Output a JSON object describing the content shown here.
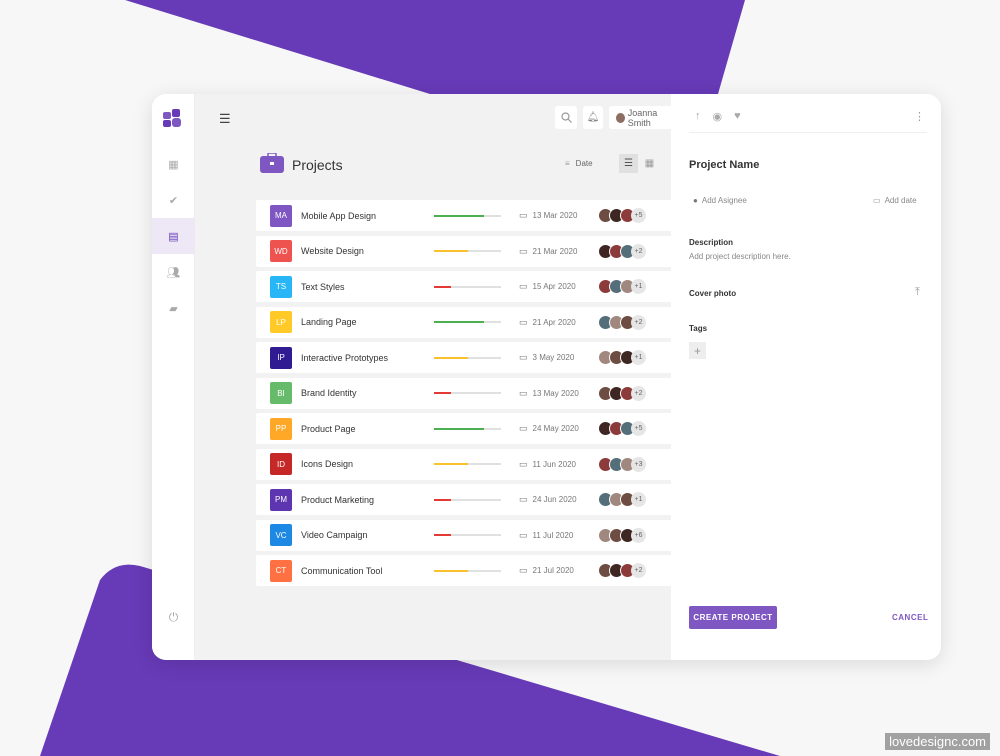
{
  "colors": {
    "accent": "#673ab7",
    "green": "#4caf50",
    "yellow": "#fbc02d",
    "red": "#e53935"
  },
  "header": {
    "user_name": "Joanna Smith",
    "icons": [
      "menu-icon",
      "search-icon",
      "bell-icon",
      "kebab-icon"
    ]
  },
  "sidebar": {
    "items": [
      {
        "icon": "dashboard-icon"
      },
      {
        "icon": "check-circle-icon"
      },
      {
        "icon": "clipboard-icon",
        "active": true
      },
      {
        "icon": "people-icon"
      },
      {
        "icon": "chat-icon"
      }
    ],
    "bottom_icon": "power-icon"
  },
  "main": {
    "title": "Projects",
    "sort_label": "Date",
    "views": [
      "list",
      "grid"
    ],
    "active_view": "list",
    "projects": [
      {
        "initials": "MA",
        "name": "Mobile App Design",
        "color": "#7e57c2",
        "progress": 75,
        "status": "green",
        "date": "13 Mar 2020",
        "extra": "+5"
      },
      {
        "initials": "WD",
        "name": "Website Design",
        "color": "#ef5350",
        "progress": 50,
        "status": "yellow",
        "date": "21 Mar 2020",
        "extra": "+2"
      },
      {
        "initials": "TS",
        "name": "Text Styles",
        "color": "#29b6f6",
        "progress": 25,
        "status": "red",
        "date": "15 Apr 2020",
        "extra": "+1"
      },
      {
        "initials": "LP",
        "name": "Landing Page",
        "color": "#ffca28",
        "progress": 75,
        "status": "green",
        "date": "21 Apr 2020",
        "extra": "+2"
      },
      {
        "initials": "IP",
        "name": "Interactive Prototypes",
        "color": "#311b92",
        "progress": 50,
        "status": "yellow",
        "date": "3 May 2020",
        "extra": "+1"
      },
      {
        "initials": "BI",
        "name": "Brand Identity",
        "color": "#66bb6a",
        "progress": 25,
        "status": "red",
        "date": "13 May 2020",
        "extra": "+2"
      },
      {
        "initials": "PP",
        "name": "Product Page",
        "color": "#ffa726",
        "progress": 75,
        "status": "green",
        "date": "24 May 2020",
        "extra": "+5"
      },
      {
        "initials": "ID",
        "name": "Icons Design",
        "color": "#c62828",
        "progress": 50,
        "status": "yellow",
        "date": "11 Jun 2020",
        "extra": "+3"
      },
      {
        "initials": "PM",
        "name": "Product Marketing",
        "color": "#5e35b1",
        "progress": 25,
        "status": "red",
        "date": "24 Jun 2020",
        "extra": "+1"
      },
      {
        "initials": "VC",
        "name": "Video Campaign",
        "color": "#1e88e5",
        "progress": 25,
        "status": "red",
        "date": "11 Jul 2020",
        "extra": "+6"
      },
      {
        "initials": "CT",
        "name": "Communication Tool",
        "color": "#ff7043",
        "progress": 50,
        "status": "yellow",
        "date": "21 Jul 2020",
        "extra": "+2"
      }
    ]
  },
  "panel": {
    "title": "Project Name",
    "assignee": "Add Asignee",
    "date": "Add date",
    "description_label": "Description",
    "description_placeholder": "Add project description here.",
    "cover_label": "Cover photo",
    "tags_label": "Tags",
    "create": "CREATE PROJECT",
    "cancel": "CANCEL"
  },
  "watermark": "lovedesignc.com"
}
